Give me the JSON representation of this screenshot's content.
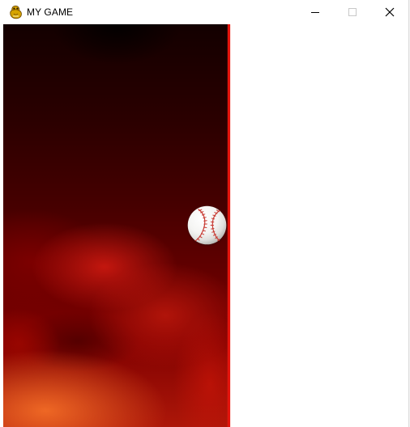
{
  "window": {
    "title": "MY GAME",
    "controls": {
      "minimize_icon": "minimize-icon",
      "maximize_icon": "maximize-icon",
      "close_icon": "close-icon"
    }
  },
  "game": {
    "background": {
      "top_color": "#130000",
      "middle_color": "#650000",
      "bottom_color": "#ad1709",
      "highlight_color": "#f26c26"
    },
    "wall_color": "#e4130c",
    "ball": {
      "icon": "baseball-icon",
      "color": "#f7f7f5",
      "stitch_color": "#c83a32"
    }
  }
}
